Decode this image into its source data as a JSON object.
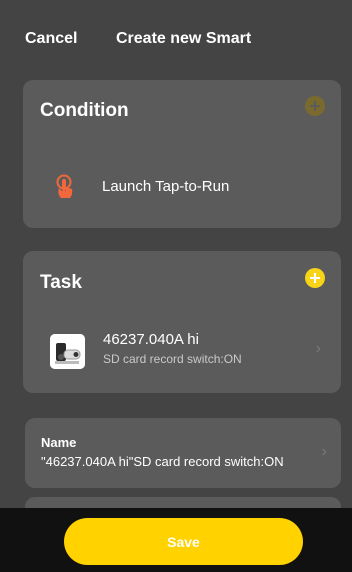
{
  "header": {
    "cancel_label": "Cancel",
    "title": "Create new Smart"
  },
  "condition": {
    "title": "Condition",
    "add_icon": "plus-icon",
    "item_icon": "tap-hand-icon",
    "item_label": "Launch Tap-to-Run"
  },
  "task": {
    "title": "Task",
    "add_icon": "plus-icon",
    "device": {
      "icon": "camera-device-icon",
      "name": "46237.040A hi",
      "action": "SD card record switch:ON"
    }
  },
  "name_field": {
    "label": "Name",
    "value": "\"46237.040A hi\"SD card record switch:ON"
  },
  "footer": {
    "save_label": "Save"
  },
  "colors": {
    "background": "#444444",
    "card": "#5b5b5b",
    "accent_yellow": "#ffd200",
    "add_disabled": "#7a6a2e",
    "tap_icon": "#f2683c",
    "bottom_bar": "#111111"
  }
}
